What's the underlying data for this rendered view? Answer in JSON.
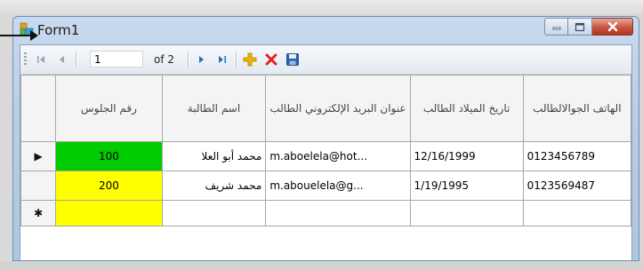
{
  "window": {
    "title": "Form1"
  },
  "toolbar": {
    "move_first_icon": "first-record-icon",
    "move_previous_icon": "previous-record-icon",
    "position_value": "1",
    "count_label": "of 2",
    "move_next_icon": "next-record-icon",
    "move_last_icon": "last-record-icon",
    "add_icon": "add-new-icon",
    "delete_icon": "delete-icon",
    "save_icon": "save-icon"
  },
  "grid": {
    "columns": [
      {
        "header": "رقم الجلوس"
      },
      {
        "header": "اسم الطالبة"
      },
      {
        "header": "عنوان البريد الإلكتروني الطالب"
      },
      {
        "header": "تاريخ الميلاد الطالب"
      },
      {
        "header": "الهاتف الجوالالطالب"
      }
    ],
    "rows": [
      {
        "indicator": "▶",
        "seat_no": "100",
        "name": "محمد أبو العلا",
        "email": "m.aboelela@hot...",
        "birth_date": "12/16/1999",
        "phone": "0123456789",
        "seat_color": "#00cc00"
      },
      {
        "indicator": "",
        "seat_no": "200",
        "name": "محمد شريف",
        "email": "m.abouelela@g...",
        "birth_date": "1/19/1995",
        "phone": "0123569487",
        "seat_color": "#ffff00"
      }
    ],
    "new_row": {
      "indicator": "✱",
      "seat_color": "#ffff00"
    }
  },
  "colors": {
    "title_bar": "#c4d6ec",
    "close_button": "#c9553e",
    "add_icon": "#f0b400",
    "delete_icon": "#e2231a",
    "save_icon": "#2a5db0",
    "nav_icon_active": "#1f6fc9",
    "nav_icon_disabled": "#9aa3ae"
  }
}
